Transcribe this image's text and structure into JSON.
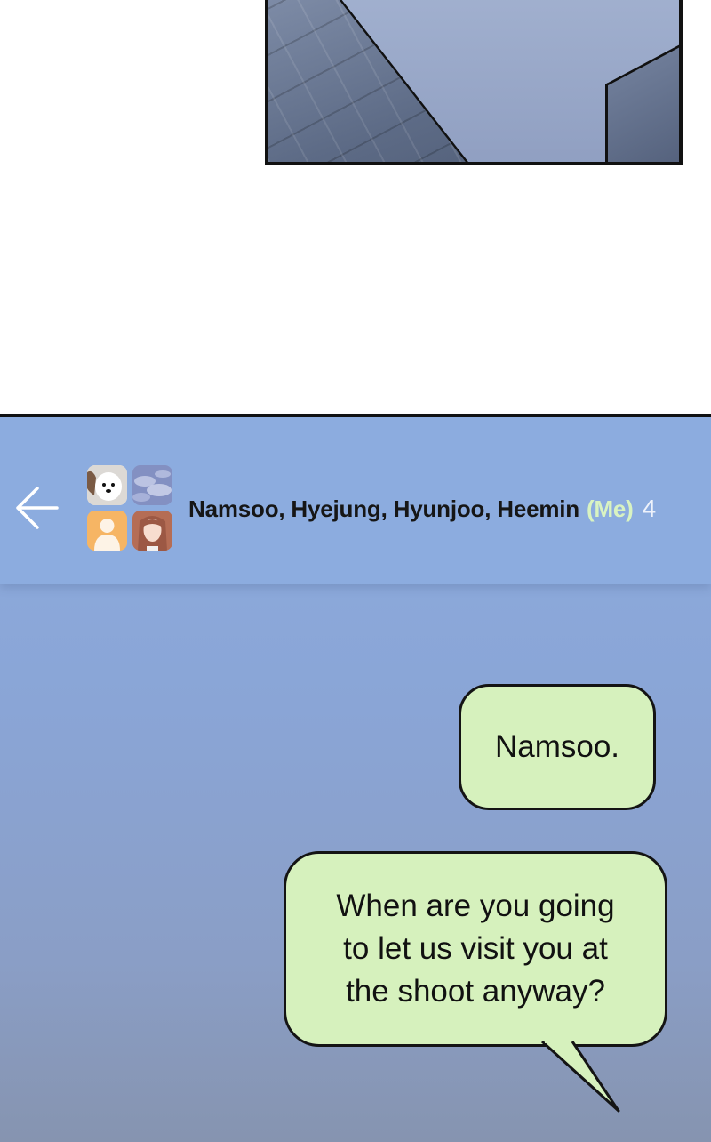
{
  "comic_panel": {
    "description_icon": "floor-shadow-scene"
  },
  "chat": {
    "back_icon": "back-arrow-icon",
    "participants": "Namsoo, Hyejung, Hyunjoo, Heemin",
    "me_label": "(Me)",
    "member_count": "4",
    "avatars": [
      "dog-avatar",
      "sky-avatar",
      "default-person-avatar",
      "girl-avatar"
    ],
    "colors": {
      "header_bg": "#8cacdf",
      "bubble_bg": "#d6f1bd",
      "me_text": "#d9f3c2"
    }
  },
  "messages": [
    {
      "text": "Namsoo."
    },
    {
      "line1": "When are you going",
      "line2": "to let us visit you at",
      "line3": "the shoot anyway?"
    }
  ]
}
